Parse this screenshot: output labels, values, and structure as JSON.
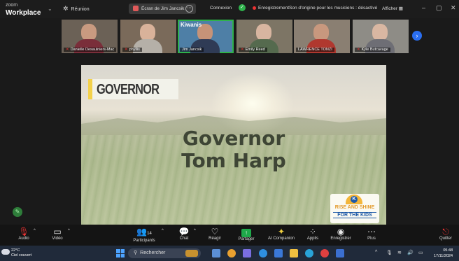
{
  "app": {
    "logo_line1": "zoom",
    "logo_line2": "Workplace",
    "meeting_label": "Réunion"
  },
  "topbar": {
    "sharing_label": "Écran de Jim Jancsik",
    "connection": "Connexion",
    "recording": "Enregistrement",
    "original_sound": "Son d'origine pour les musiciens : désactivé",
    "display": "Afficher"
  },
  "participants": [
    {
      "name": "Danielle Desaulniers-Mac",
      "skin": "#c89a80",
      "shirt": "#7a2e3a",
      "bg": "#6b6156"
    },
    {
      "name": "phyllis",
      "skin": "#d9b29a",
      "shirt": "#b5b0a8",
      "bg": "#7a6a5a"
    },
    {
      "name": "Jim Jancsik",
      "skin": "#c69378",
      "shirt": "#2f3b55",
      "bg": "#4e7fa6",
      "badge": "Kiwanis"
    },
    {
      "name": "Emily Reed",
      "skin": "#d8b5a0",
      "shirt": "#556a4e",
      "bg": "#7d7565"
    },
    {
      "name": "LAWRENCE TONZI",
      "skin": "#c8987e",
      "shirt": "#b0382f",
      "bg": "#8a7f72"
    },
    {
      "name": "Kyle Butcavage",
      "skin": "#d9b7a2",
      "shirt": "#6e6e75",
      "bg": "#8e8c86"
    }
  ],
  "slide": {
    "badge": "GOVERNOR",
    "title_line1": "Governor",
    "title_line2": "Tom Harp",
    "logo_letter": "K",
    "logo_line1": "RISE AND SHINE",
    "logo_line2": "FOR THE KIDS"
  },
  "controls": {
    "audio": "Audio",
    "video": "Vidéo",
    "participants": "Participants",
    "participants_count": "14",
    "chat": "Chat",
    "react": "Réagir",
    "share": "Partager",
    "ai": "AI Companion",
    "apps": "Applis",
    "record": "Enregistrer",
    "more": "Plus",
    "leave": "Quitter"
  },
  "taskbar": {
    "temperature": "22°C",
    "weather": "Ciel couvert",
    "search_placeholder": "Rechercher",
    "time": "05:48",
    "date": "17/11/2024"
  },
  "colors": {
    "accent_green": "#2fb24c",
    "share_green": "#1fa84a",
    "next_blue": "#2a6ef0"
  }
}
